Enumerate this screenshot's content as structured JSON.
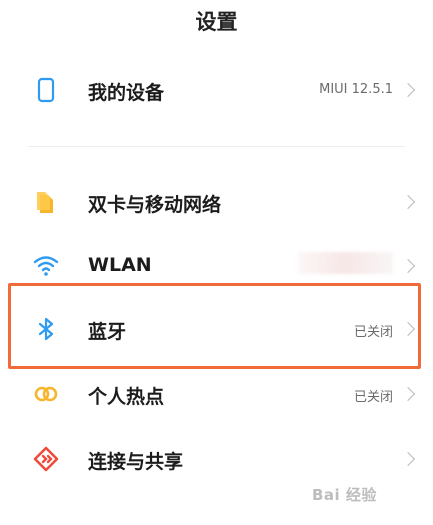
{
  "header": {
    "title": "设置"
  },
  "items": [
    {
      "label": "我的设备",
      "value": "MIUI 12.5.1",
      "icon": "device-icon"
    },
    {
      "label": "双卡与移动网络",
      "value": "",
      "icon": "sim-card-icon"
    },
    {
      "label": "WLAN",
      "value": "",
      "icon": "wifi-icon"
    },
    {
      "label": "蓝牙",
      "value": "已关闭",
      "icon": "bluetooth-icon"
    },
    {
      "label": "个人热点",
      "value": "已关闭",
      "icon": "hotspot-icon"
    },
    {
      "label": "连接与共享",
      "value": "",
      "icon": "connection-share-icon"
    }
  ],
  "watermark": {
    "text": "Bai 经验"
  },
  "colors": {
    "accent_highlight": "#f06a3a",
    "blue": "#2f9bf0",
    "yellow": "#f7b52c",
    "red": "#ee4d3c"
  }
}
